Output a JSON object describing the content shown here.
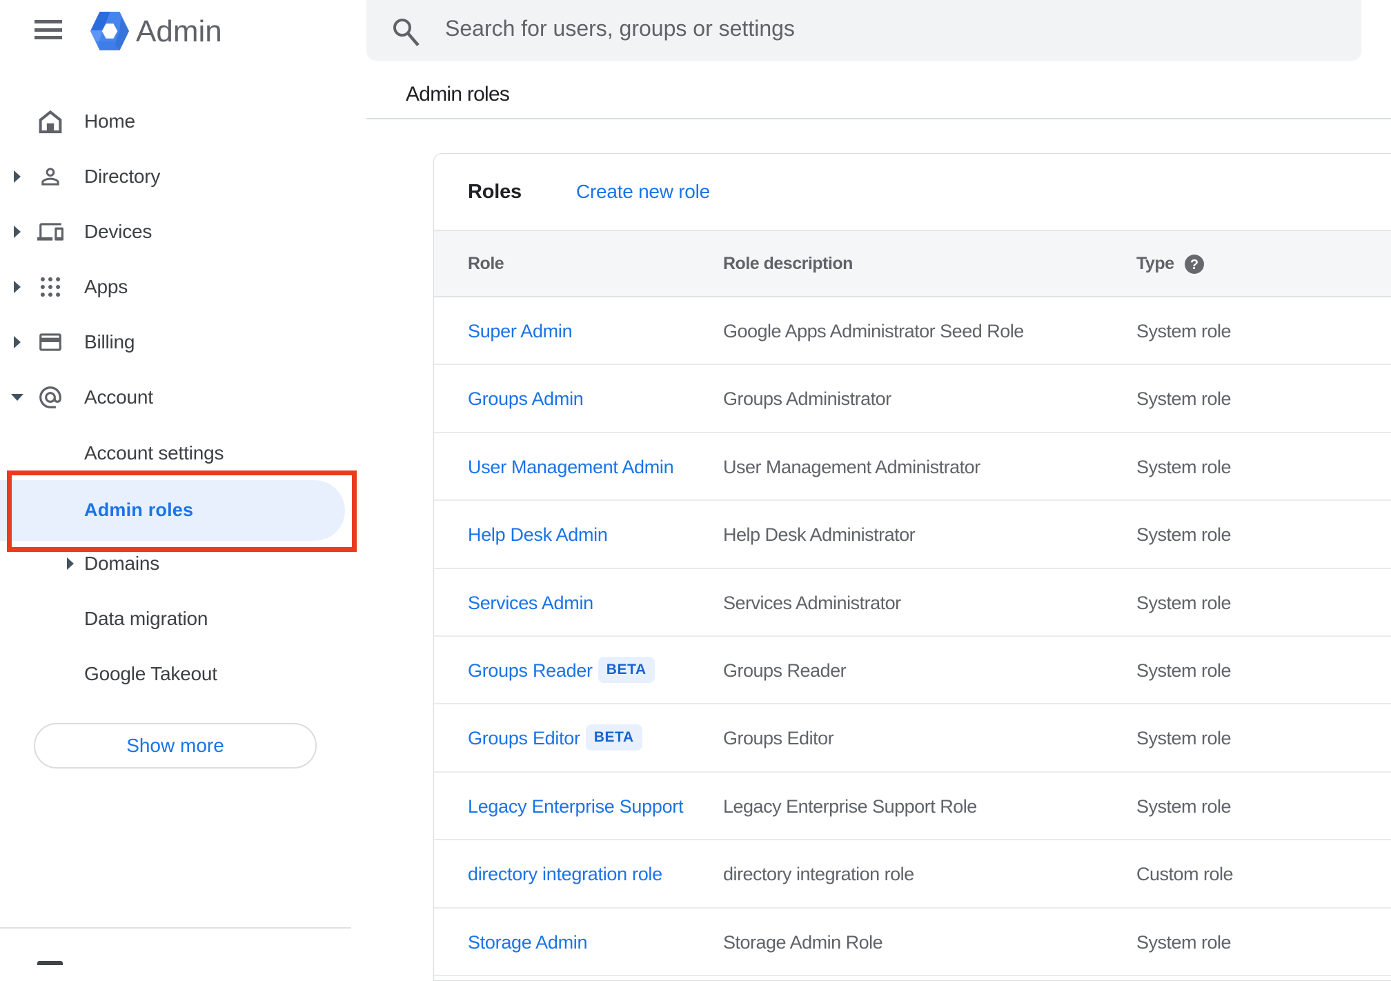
{
  "app": {
    "product_name": "Admin"
  },
  "search": {
    "placeholder": "Search for users, groups or settings"
  },
  "page": {
    "title": "Admin roles"
  },
  "sidebar": {
    "items": [
      {
        "label": "Home",
        "expandable": false
      },
      {
        "label": "Directory",
        "expandable": true
      },
      {
        "label": "Devices",
        "expandable": true
      },
      {
        "label": "Apps",
        "expandable": true
      },
      {
        "label": "Billing",
        "expandable": true
      },
      {
        "label": "Account",
        "expandable": true,
        "expanded": true
      }
    ],
    "submenu": [
      {
        "label": "Account settings",
        "selected": false
      },
      {
        "label": "Admin roles",
        "selected": true
      },
      {
        "label": "Domains",
        "expandable": true
      },
      {
        "label": "Data migration"
      },
      {
        "label": "Google Takeout"
      }
    ],
    "show_more_label": "Show more"
  },
  "annotation": {
    "shape": "red-box",
    "color": "#ea3a20",
    "target": "Admin roles"
  },
  "card": {
    "title": "Roles",
    "action_label": "Create new role",
    "columns": {
      "role": "Role",
      "description": "Role description",
      "type": "Type"
    },
    "rows": [
      {
        "role": "Super Admin",
        "description": "Google Apps Administrator Seed Role",
        "type": "System role"
      },
      {
        "role": "Groups Admin",
        "description": "Groups Administrator",
        "type": "System role"
      },
      {
        "role": "User Management Admin",
        "description": "User Management Administrator",
        "type": "System role"
      },
      {
        "role": "Help Desk Admin",
        "description": "Help Desk Administrator",
        "type": "System role"
      },
      {
        "role": "Services Admin",
        "description": "Services Administrator",
        "type": "System role"
      },
      {
        "role": "Groups Reader",
        "badge": "BETA",
        "description": "Groups Reader",
        "type": "System role"
      },
      {
        "role": "Groups Editor",
        "badge": "BETA",
        "description": "Groups Editor",
        "type": "System role"
      },
      {
        "role": "Legacy Enterprise Support",
        "description": "Legacy Enterprise Support Role",
        "type": "System role"
      },
      {
        "role": "directory integration role",
        "description": "directory integration role",
        "type": "Custom role"
      },
      {
        "role": "Storage Admin",
        "description": "Storage Admin Role",
        "type": "System role"
      }
    ]
  },
  "colors": {
    "accent_blue": "#1a73e8",
    "selected_pill": "#e8f0fe",
    "annotation_red": "#ea3a20",
    "text_primary": "#202124",
    "text_secondary": "#5f6368"
  }
}
